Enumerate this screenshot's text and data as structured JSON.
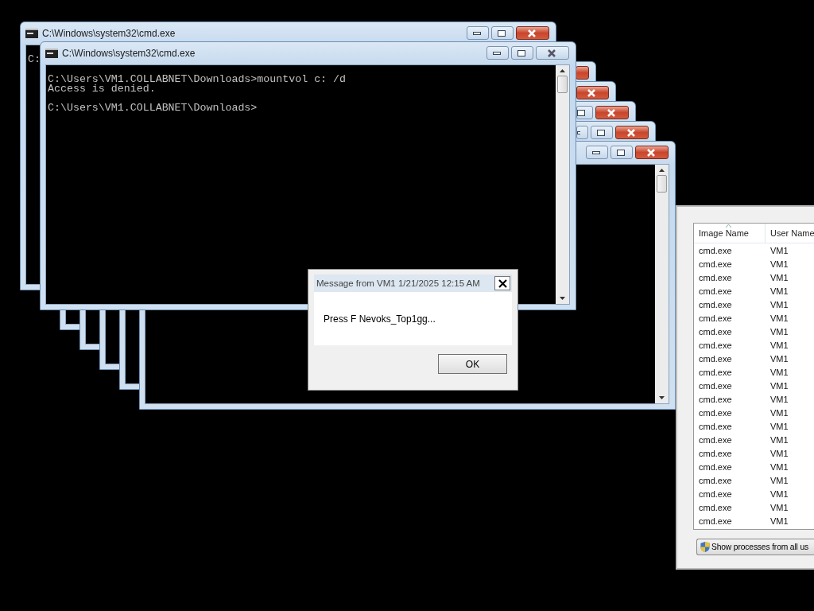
{
  "windows": [
    {
      "title": "C:\\Windows\\system32\\cmd.exe",
      "active": true,
      "lines": [
        [
          "C:"
        ]
      ]
    },
    {
      "active": true
    },
    {
      "active": true
    },
    {
      "active": true
    },
    {
      "active": true
    },
    {
      "active": true,
      "scrollbar": true
    },
    {
      "title": "C:\\Windows\\system32\\cmd.exe",
      "active": false,
      "scrollbar": true,
      "lines": [
        [
          "C:\\Users\\VM1.COLLABNET\\Downloads>mountvol c: /d",
          "Access is denied."
        ],
        [
          "C:\\Users\\VM1.COLLABNET\\Downloads>"
        ]
      ]
    }
  ],
  "dialog": {
    "title": "Message from VM1 1/21/2025 12:15 AM",
    "message": "Press F Nevoks_Top1gg...",
    "button": "OK"
  },
  "task_manager": {
    "columns": [
      "Image Name",
      "User Name"
    ],
    "rows": [
      {
        "image_name": "cmd.exe",
        "user_name": "VM1"
      },
      {
        "image_name": "cmd.exe",
        "user_name": "VM1"
      },
      {
        "image_name": "cmd.exe",
        "user_name": "VM1"
      },
      {
        "image_name": "cmd.exe",
        "user_name": "VM1"
      },
      {
        "image_name": "cmd.exe",
        "user_name": "VM1"
      },
      {
        "image_name": "cmd.exe",
        "user_name": "VM1"
      },
      {
        "image_name": "cmd.exe",
        "user_name": "VM1"
      },
      {
        "image_name": "cmd.exe",
        "user_name": "VM1"
      },
      {
        "image_name": "cmd.exe",
        "user_name": "VM1"
      },
      {
        "image_name": "cmd.exe",
        "user_name": "VM1"
      },
      {
        "image_name": "cmd.exe",
        "user_name": "VM1"
      },
      {
        "image_name": "cmd.exe",
        "user_name": "VM1"
      },
      {
        "image_name": "cmd.exe",
        "user_name": "VM1"
      },
      {
        "image_name": "cmd.exe",
        "user_name": "VM1"
      },
      {
        "image_name": "cmd.exe",
        "user_name": "VM1"
      },
      {
        "image_name": "cmd.exe",
        "user_name": "VM1"
      },
      {
        "image_name": "cmd.exe",
        "user_name": "VM1"
      },
      {
        "image_name": "cmd.exe",
        "user_name": "VM1"
      },
      {
        "image_name": "cmd.exe",
        "user_name": "VM1"
      },
      {
        "image_name": "cmd.exe",
        "user_name": "VM1"
      },
      {
        "image_name": "cmd.exe",
        "user_name": "VM1"
      }
    ],
    "button": "Show processes from all us"
  }
}
